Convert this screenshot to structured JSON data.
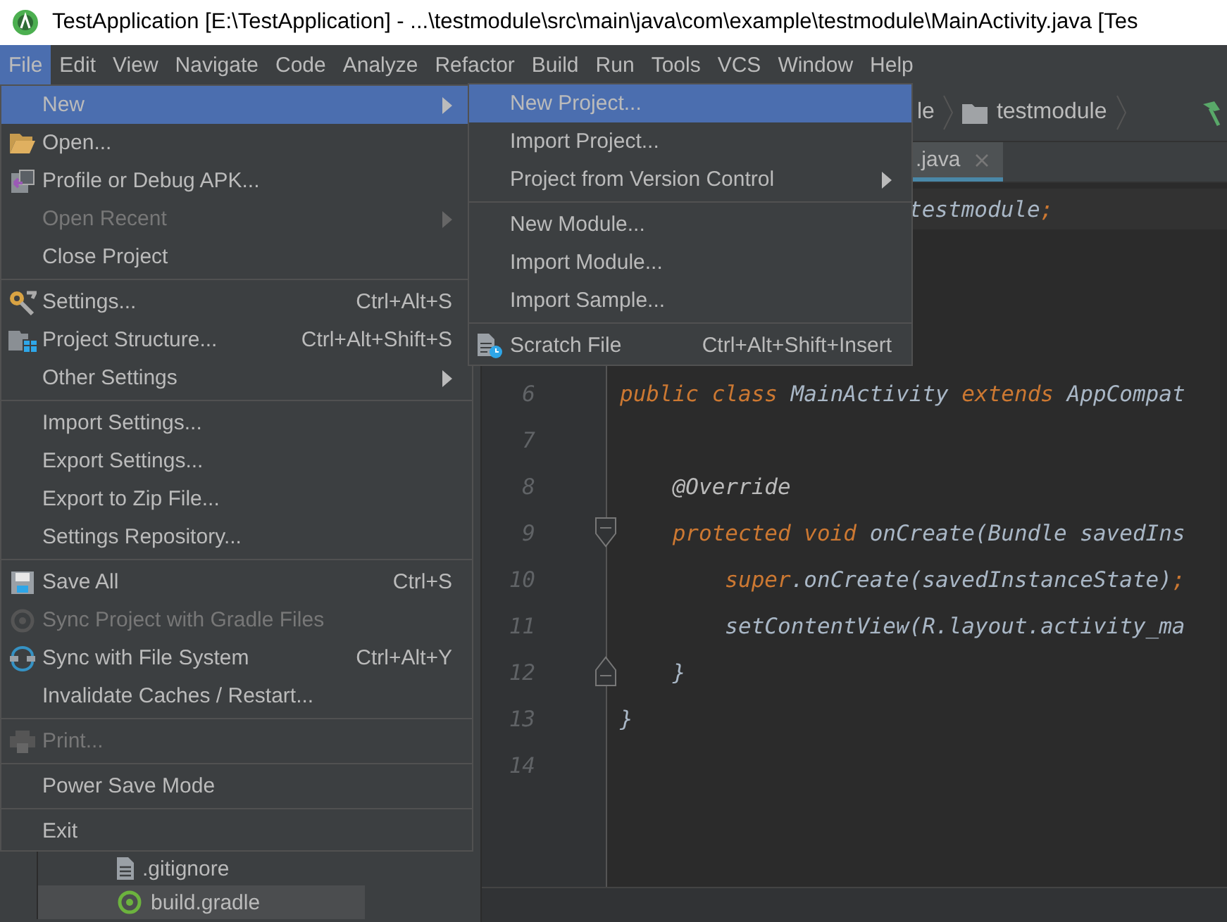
{
  "window": {
    "title": "TestApplication [E:\\TestApplication] - ...\\testmodule\\src\\main\\java\\com\\example\\testmodule\\MainActivity.java [Tes"
  },
  "menu_bar": [
    {
      "label": "File",
      "selected": true
    },
    {
      "label": "Edit",
      "selected": false
    },
    {
      "label": "View",
      "selected": false
    },
    {
      "label": "Navigate",
      "selected": false
    },
    {
      "label": "Code",
      "selected": false
    },
    {
      "label": "Analyze",
      "selected": false
    },
    {
      "label": "Refactor",
      "selected": false
    },
    {
      "label": "Build",
      "selected": false
    },
    {
      "label": "Run",
      "selected": false
    },
    {
      "label": "Tools",
      "selected": false
    },
    {
      "label": "VCS",
      "selected": false
    },
    {
      "label": "Window",
      "selected": false
    },
    {
      "label": "Help",
      "selected": false
    }
  ],
  "breadcrumbs": [
    {
      "label": "le",
      "kind": "module"
    },
    {
      "label": "testmodule",
      "kind": "folder"
    }
  ],
  "editor_tab": {
    "label": ".java",
    "selected": true
  },
  "project_tree": [
    {
      "label": ".gitignore",
      "kind": "file",
      "selected": false
    },
    {
      "label": "build.gradle",
      "kind": "gradle",
      "selected": true
    }
  ],
  "code_lines": [
    {
      "tokens": [
        {
          "text": "testmodule",
          "kind": "plain"
        },
        {
          "text": ";",
          "kind": "keyword"
        }
      ]
    },
    {
      "number": "6",
      "tokens": [
        {
          "text": "public class ",
          "kind": "keyword"
        },
        {
          "text": "MainActivity ",
          "kind": "plain"
        },
        {
          "text": "extends ",
          "kind": "keyword"
        },
        {
          "text": "AppCompat",
          "kind": "plain"
        }
      ]
    },
    {
      "number": "7"
    },
    {
      "number": "8",
      "tokens": [
        {
          "text": "    @Override",
          "kind": "annotation"
        }
      ]
    },
    {
      "number": "9",
      "kind": "fold-start",
      "tokens": [
        {
          "text": "    protected void ",
          "kind": "keyword"
        },
        {
          "text": "onCreate(Bundle savedIns",
          "kind": "plain"
        }
      ]
    },
    {
      "number": "10",
      "tokens": [
        {
          "text": "        super",
          "kind": "keyword"
        },
        {
          "text": ".onCreate(savedInstanceState)",
          "kind": "plain"
        },
        {
          "text": ";",
          "kind": "keyword"
        }
      ]
    },
    {
      "number": "11",
      "tokens": [
        {
          "text": "        setContentView(R.layout.activity_ma",
          "kind": "plain"
        }
      ]
    },
    {
      "number": "12",
      "kind": "fold-end",
      "tokens": [
        {
          "text": "    }",
          "kind": "plain"
        }
      ]
    },
    {
      "number": "13",
      "tokens": [
        {
          "text": "}",
          "kind": "plain"
        }
      ]
    },
    {
      "number": "14"
    }
  ],
  "file_menu": {
    "sections": [
      {
        "items": [
          {
            "label": "New",
            "submenu": true,
            "selected": true,
            "disabled": false
          },
          {
            "label": "Open...",
            "kind": "folder",
            "selected": false,
            "disabled": false
          },
          {
            "label": "Profile or Debug APK...",
            "kind": "apk",
            "selected": false,
            "disabled": false
          },
          {
            "label": "Open Recent",
            "submenu": true,
            "selected": false,
            "disabled": true
          },
          {
            "label": "Close Project",
            "selected": false,
            "disabled": false
          }
        ]
      },
      {
        "items": [
          {
            "label": "Settings...",
            "kind": "wrench",
            "shortcut": "Ctrl+Alt+S",
            "selected": false,
            "disabled": false
          },
          {
            "label": "Project Structure...",
            "kind": "structure",
            "shortcut": "Ctrl+Alt+Shift+S",
            "selected": false,
            "disabled": false
          },
          {
            "label": "Other Settings",
            "submenu": true,
            "selected": false,
            "disabled": false
          }
        ]
      },
      {
        "items": [
          {
            "label": "Import Settings...",
            "selected": false,
            "disabled": false
          },
          {
            "label": "Export Settings...",
            "selected": false,
            "disabled": false
          },
          {
            "label": "Export to Zip File...",
            "selected": false,
            "disabled": false
          },
          {
            "label": "Settings Repository...",
            "selected": false,
            "disabled": false
          }
        ]
      },
      {
        "items": [
          {
            "label": "Save All",
            "kind": "save",
            "shortcut": "Ctrl+S",
            "selected": false,
            "disabled": false
          },
          {
            "label": "Sync Project with Gradle Files",
            "kind": "gradle-sync",
            "selected": false,
            "disabled": true
          },
          {
            "label": "Sync with File System",
            "kind": "sync",
            "shortcut": "Ctrl+Alt+Y",
            "selected": false,
            "disabled": false
          },
          {
            "label": "Invalidate Caches / Restart...",
            "selected": false,
            "disabled": false
          }
        ]
      },
      {
        "items": [
          {
            "label": "Print...",
            "kind": "print",
            "selected": false,
            "disabled": true
          }
        ]
      },
      {
        "items": [
          {
            "label": "Power Save Mode",
            "selected": false,
            "disabled": false
          }
        ]
      },
      {
        "items": [
          {
            "label": "Exit",
            "selected": false,
            "disabled": false
          }
        ]
      }
    ]
  },
  "new_submenu": {
    "sections": [
      {
        "items": [
          {
            "label": "New Project...",
            "selected": true,
            "disabled": false
          },
          {
            "label": "Import Project...",
            "selected": false,
            "disabled": false
          },
          {
            "label": "Project from Version Control",
            "submenu": true,
            "selected": false,
            "disabled": false
          }
        ]
      },
      {
        "items": [
          {
            "label": "New Module...",
            "selected": false,
            "disabled": false
          },
          {
            "label": "Import Module...",
            "selected": false,
            "disabled": false
          },
          {
            "label": "Import Sample...",
            "selected": false,
            "disabled": false
          }
        ]
      },
      {
        "items": [
          {
            "label": "Scratch File",
            "kind": "scratch",
            "shortcut": "Ctrl+Alt+Shift+Insert",
            "selected": false,
            "disabled": false
          }
        ]
      }
    ]
  }
}
